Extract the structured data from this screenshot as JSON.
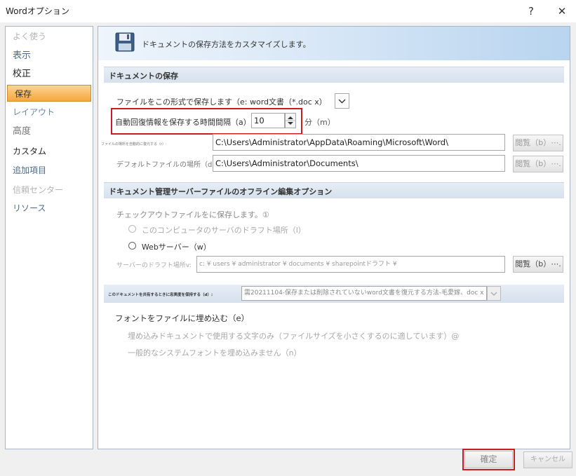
{
  "window": {
    "title": "Wordオプション",
    "help_label": "?",
    "close_label": "✕"
  },
  "sidebar": {
    "items": [
      {
        "label": "よく使う"
      },
      {
        "label": "表示"
      },
      {
        "label": "校正"
      },
      {
        "label": "保存"
      },
      {
        "label": "レイアウト"
      },
      {
        "label": "高度"
      },
      {
        "label": "カスタム"
      },
      {
        "label": "追加項目"
      },
      {
        "label": "信頼センター"
      },
      {
        "label": "リソース"
      }
    ]
  },
  "main": {
    "header": "ドキュメントの保存方法をカスタマイズします。",
    "save_section": {
      "title": "ドキュメントの保存",
      "format_label": "ファイルをこの形式で保存します（e: word文書（*.doc x）",
      "autorecover_label": "自動回復情報を保存する時間間隔（a）",
      "autorecover_value": "10",
      "autorecover_unit": "分（m）",
      "autorecover_location_label": "ファイルの場所を自動的に復元する（r）:",
      "autorecover_location_value": "C:\\Users\\Administrator\\AppData\\Roaming\\Microsoft\\Word\\",
      "default_location_label": "デフォルトファイルの場所（d:",
      "default_location_value": "C:\\Users\\Administrator\\Documents\\",
      "browse_label": "閲覧（b）⋯."
    },
    "offline_section": {
      "title": "ドキュメント管理サーバーファイルのオフライン編集オプション",
      "checkout_label": "チェックアウトファイルをに保存します。①",
      "option_local": "このコンピュータのサーバのドラフト場所（l）",
      "option_web": "Webサーバー（w）",
      "drafts_label": "サーバーのドラフト場所v:",
      "drafts_value": "c: ¥ users ¥ administrator ¥ documents ¥ sharepointドラフト ¥",
      "browse_label": "閲覧（b）⋯."
    },
    "fidelity": {
      "label": "このドキュメントを共有するときに忠実度を保持する（d）:",
      "doc_value": "需20211104-保存または削除されていないword文書を復元する方法-毛愛嫁、doc x"
    },
    "embed": {
      "label": "フォントをファイルに埋め込む（e）",
      "option1": "埋め込みドキュメントで使用する文字のみ（ファイルサイズを小さくするのに適しています）@",
      "option2": "一般的なシステムフォントを埋め込みません（n）"
    }
  },
  "footer": {
    "ok_label": "確定",
    "cancel_label": "キャンセル"
  },
  "colors": {
    "accent_selected": "#f6a73e",
    "highlight_red": "#c81e23",
    "section_bg": "#dde6f0"
  }
}
